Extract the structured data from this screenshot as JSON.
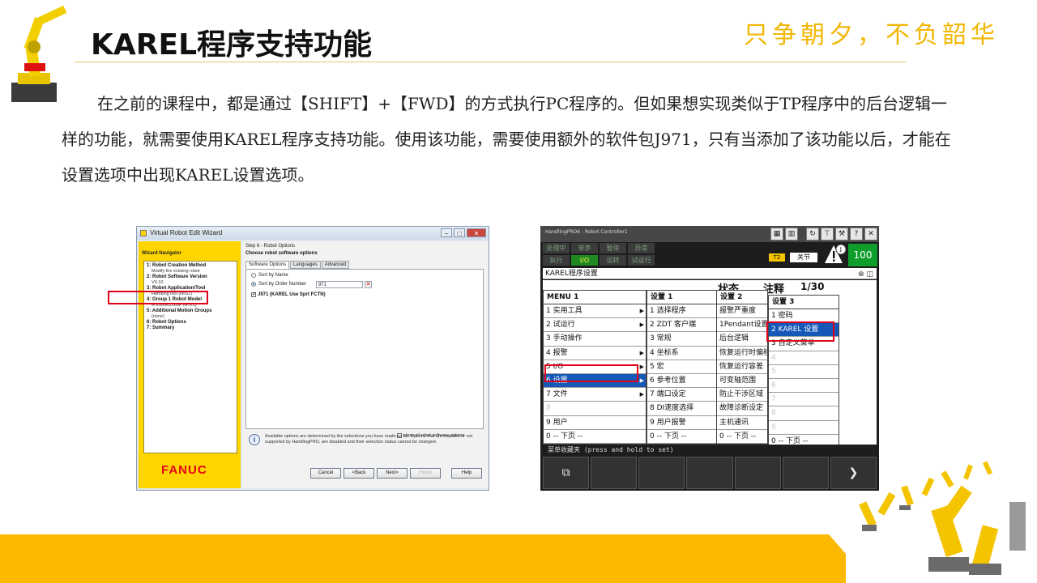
{
  "header": {
    "title": "KAREL程序支持功能",
    "slogan": "只争朝夕，不负韶华"
  },
  "body": {
    "paragraph": "在之前的课程中，都是通过【SHIFT】+【FWD】的方式执行PC程序的。但如果想实现类似于TP程序中的后台逻辑一样的功能，就需要使用KAREL程序支持功能。使用该功能，需要使用额外的软件包J971，只有当添加了该功能以后，才能在设置选项中出现KAREL设置选项。"
  },
  "wizard": {
    "window_title": "Virtual Robot Edit Wizard",
    "nav_header": "Wizard Navigator",
    "nav": [
      {
        "label": "1: Robot Creation Method",
        "sub": "Modify the existing robot"
      },
      {
        "label": "2: Robot Software Version",
        "sub": "V9.10"
      },
      {
        "label": "3: Robot Application/Tool",
        "sub": "HandlingTool (H552)"
      },
      {
        "label": "4: Group 1 Robot Model",
        "sub": "R-2000iC/165F (H721)"
      },
      {
        "label": "5: Additional Motion Groups",
        "sub": "(none)"
      },
      {
        "label": "6: Robot Options",
        "sub": ""
      },
      {
        "label": "7: Summary",
        "sub": ""
      }
    ],
    "brand": "FANUC",
    "step": "Step 6 - Robot Options",
    "choose": "Choose robot software options",
    "tabs": [
      "Software Options",
      "Languages",
      "Advanced"
    ],
    "sort_by_name": "Sort by Name",
    "sort_by_order": "Sort by Order Number",
    "order_filter": "971",
    "option_label": "J971 (KAREL Use Sprt FCTN)",
    "show_all": "show all robot software options",
    "info_text": "Available options are determined by the selections you have made so far. Options that are required or not supported by HandlingPRO, are disabled and their selection status cannot be changed.",
    "buttons": {
      "cancel": "Cancel",
      "back": "<Back",
      "next": "Next>",
      "finish": "Finish",
      "help": "Help"
    }
  },
  "pendant": {
    "window_title": "HandlingPRO6 - Robot Controller1",
    "status": [
      "处理中",
      "单步",
      "暂停",
      "异常",
      "执行",
      "I/O",
      "运转",
      "试运行"
    ],
    "t2": "T2",
    "joint": "关节",
    "override": "100",
    "subhead": "KAREL程序设置",
    "state_head": "状态",
    "comment_head": "注释",
    "page_head": "1/30",
    "menu1": {
      "head": "MENU  1",
      "items": [
        "1 实用工具",
        "2 试运行",
        "3 手动操作",
        "4 报警",
        "5 I/O",
        "6 设置",
        "7 文件",
        "8",
        "9 用户",
        "0 -- 下页 --"
      ]
    },
    "menu2": {
      "head": "设置  1",
      "items": [
        "1 选择程序",
        "2 ZDT 客户端",
        "3 常规",
        "4 坐标系",
        "5 宏",
        "6 参考位置",
        "7 端口设定",
        "8 DI速度选择",
        "9 用户报警",
        "0 -- 下页 --"
      ]
    },
    "menu3": {
      "head": "设置  2",
      "items": [
        "报警严重度",
        "1Pendant设置",
        "后台逻辑",
        "恢复运行时偏移",
        "恢复运行容差",
        "可变轴范围",
        "防止干涉区域",
        "故障诊断设定",
        "主机通讯",
        "0 -- 下页 --"
      ]
    },
    "menu4": {
      "head": "设置  3",
      "items": [
        "1 密码",
        "2 KAREL 设置",
        "3 自定义菜单",
        "4",
        "5",
        "6",
        "7",
        "8",
        "9",
        "0 -- 下页 --"
      ]
    },
    "fav_bar": "菜单收藏夹 (press and hold to set)"
  },
  "colors": {
    "accent": "#fbb900",
    "highlight": "#e2001a",
    "selection": "#1658b8"
  }
}
